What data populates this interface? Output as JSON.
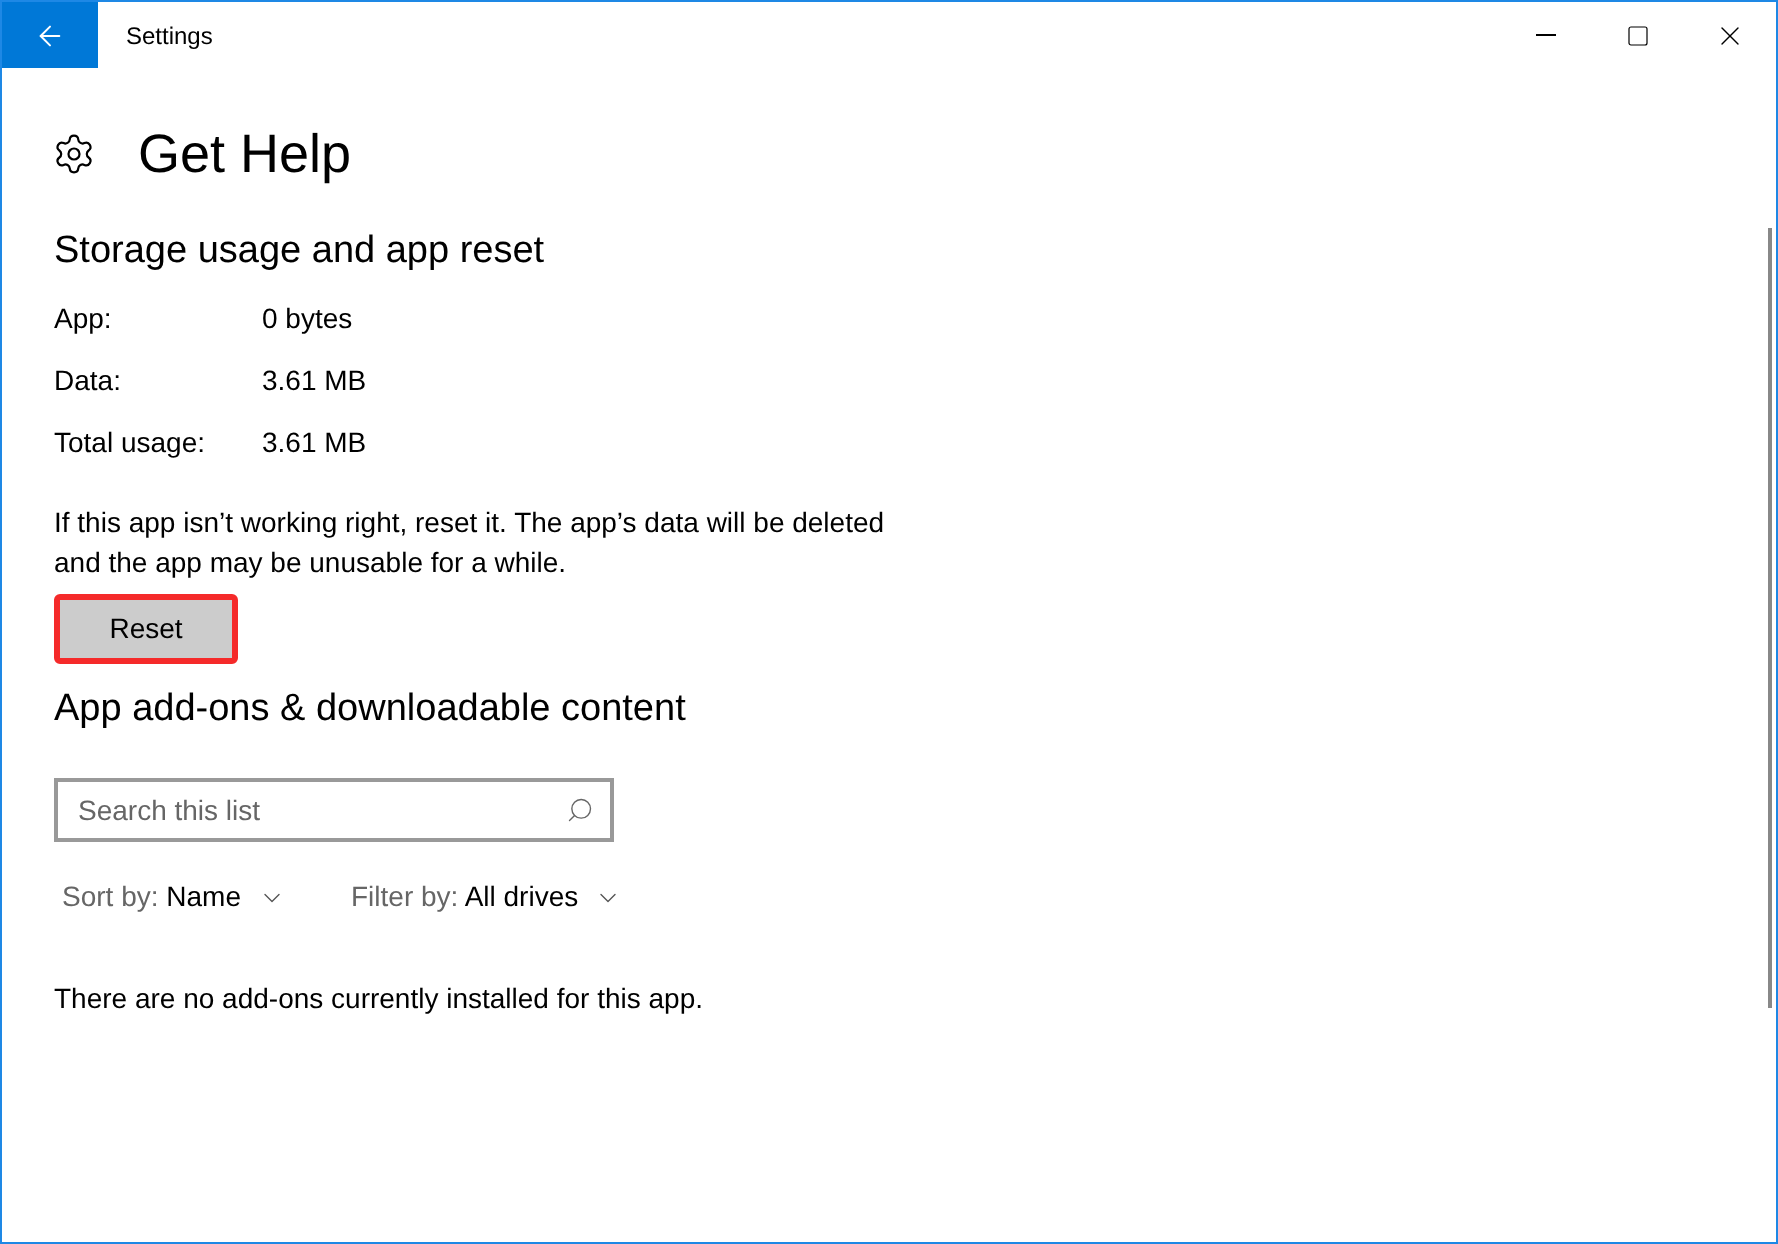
{
  "window": {
    "title": "Settings"
  },
  "page": {
    "title": "Get Help"
  },
  "storage": {
    "heading": "Storage usage and app reset",
    "rows": [
      {
        "label": "App:",
        "value": "0 bytes"
      },
      {
        "label": "Data:",
        "value": "3.61 MB"
      },
      {
        "label": "Total usage:",
        "value": "3.61 MB"
      }
    ],
    "description": "If this app isn’t working right, reset it. The app’s data will be deleted and the app may be unusable for a while.",
    "reset_button": {
      "label": "Reset",
      "highlighted": true
    }
  },
  "addons": {
    "heading": "App add-ons & downloadable content",
    "search": {
      "placeholder": "Search this list"
    },
    "sort": {
      "label": "Sort by:",
      "value": "Name"
    },
    "filter": {
      "label": "Filter by:",
      "value": "All drives"
    },
    "empty_message": "There are no add-ons currently installed for this app."
  }
}
